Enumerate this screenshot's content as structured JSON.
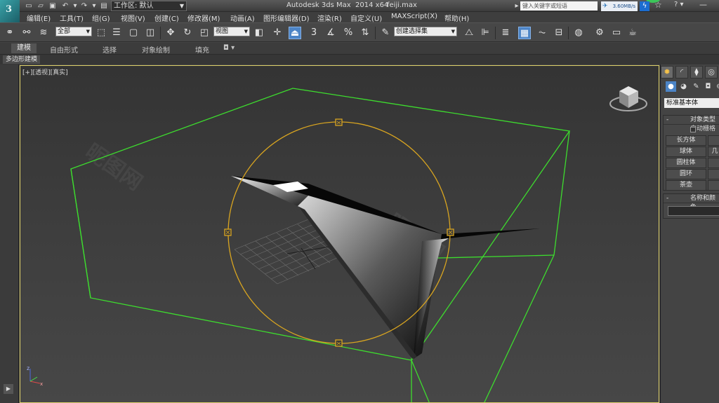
{
  "titlebar": {
    "workspace_label": "工作区: 默认",
    "app_title": "Autodesk 3ds Max  2014 x64",
    "file_name": "feiji.max",
    "search_placeholder": "键入关键字或短语",
    "net_speed": "3.60MB/s",
    "help_label": "?"
  },
  "menu": {
    "items": [
      "编辑(E)",
      "工具(T)",
      "组(G)",
      "视图(V)",
      "创建(C)",
      "修改器(M)",
      "动画(A)",
      "图形编辑器(D)",
      "渲染(R)",
      "自定义(U)",
      "MAXScript(X)",
      "帮助(H)"
    ]
  },
  "toolbar": {
    "selection_filter": "全部",
    "ref_coord": "视图",
    "snap_label": "3",
    "named_selection": "创建选择集"
  },
  "ribbon": {
    "tabs": [
      "建模",
      "自由形式",
      "选择",
      "对象绘制",
      "填充"
    ],
    "sub_label": "多边形建模"
  },
  "viewport": {
    "label": "[+][透视][真实]"
  },
  "command_panel": {
    "category": "标准基本体",
    "object_type_title": "对象类型",
    "autogrid_label": "自动栅格",
    "buttons": [
      "长方体",
      "球体",
      "圆柱体",
      "圆环",
      "茶壶"
    ],
    "buttons_right": [
      "",
      "几",
      "",
      "",
      ""
    ],
    "name_color_title": "名称和颜色"
  },
  "colors": {
    "accent": "#4c84c6",
    "bbox_green": "#3ddc2e",
    "gizmo_yellow": "#d9a520",
    "viewport_border": "#ddd06a"
  }
}
